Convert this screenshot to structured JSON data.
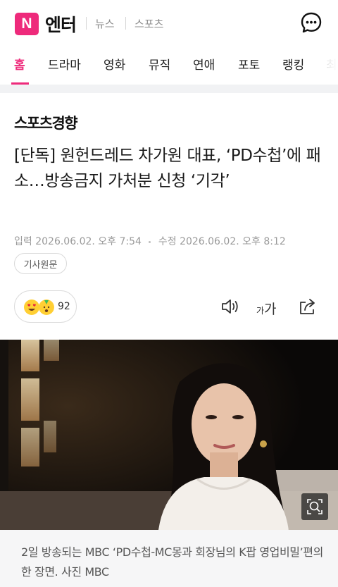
{
  "header": {
    "logo_letter": "N",
    "brand": "엔터",
    "links": [
      "뉴스",
      "스포츠"
    ]
  },
  "tabs": [
    {
      "label": "홈",
      "active": true
    },
    {
      "label": "드라마",
      "active": false
    },
    {
      "label": "영화",
      "active": false
    },
    {
      "label": "뮤직",
      "active": false
    },
    {
      "label": "연애",
      "active": false
    },
    {
      "label": "포토",
      "active": false
    },
    {
      "label": "랭킹",
      "active": false
    },
    {
      "label": "최",
      "active": false
    }
  ],
  "article": {
    "press": "스포츠경향",
    "headline": "[단독] 원헌드레드 차가원 대표, ‘PD수첩’에 패소…방송금지 가처분 신청 ‘기각’",
    "input_label": "입력",
    "input_time": "2026.06.02. 오후 7:54",
    "modified_label": "수정",
    "modified_time": "2026.06.02. 오후 8:12",
    "origin_button": "기사원문",
    "reaction_count": "92",
    "font_small": "가",
    "font_large": "가"
  },
  "photo": {
    "caption": "2일 방송되는 MBC ‘PD수첩-MC몽과 회장님의 K팝 영업비밀’편의 한 장면. 사진 MBC"
  },
  "colors": {
    "accent": "#ee2a7b",
    "divider": "#f1f2f4",
    "caption_bg": "#f6f6f7"
  },
  "icons": [
    "chat-icon",
    "speaker-icon",
    "font-size-icon",
    "share-icon",
    "zoom-icon",
    "heart-eyes-emoji-icon",
    "party-emoji-icon"
  ]
}
